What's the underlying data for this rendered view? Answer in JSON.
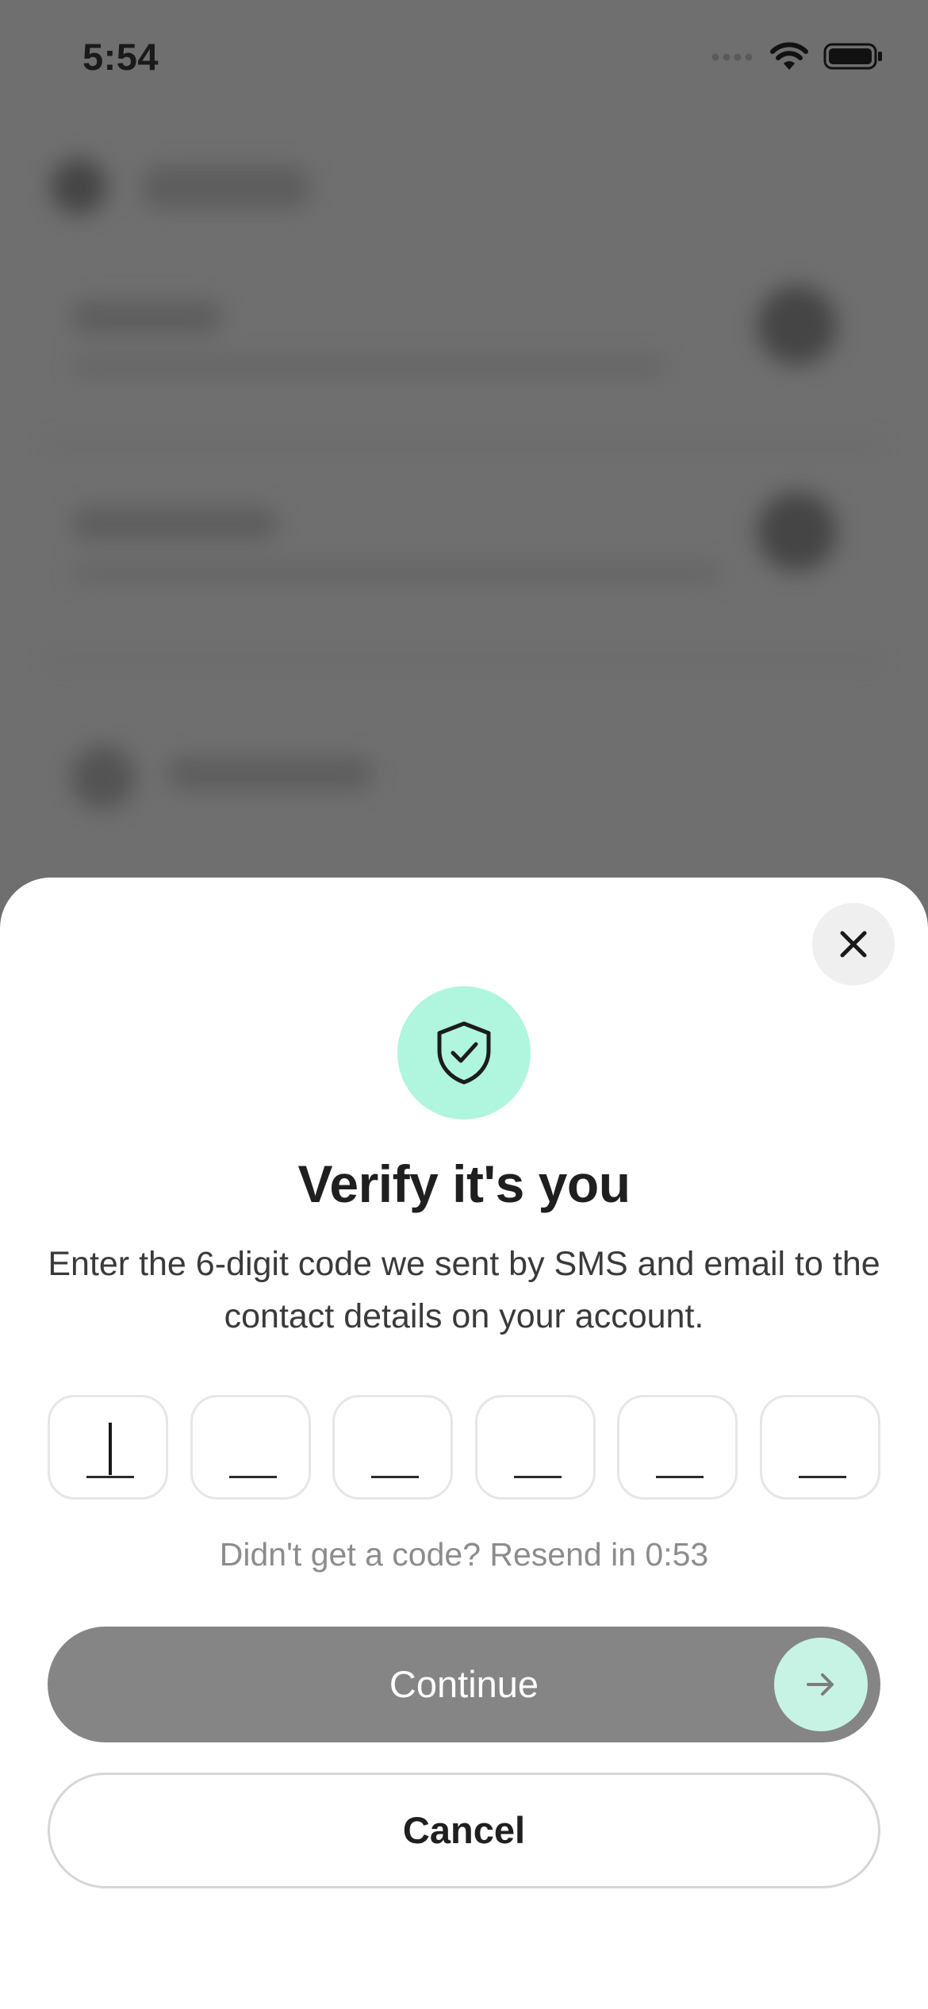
{
  "status_bar": {
    "time": "5:54"
  },
  "sheet": {
    "close_icon": "close-icon",
    "badge_icon": "shield-check-icon",
    "title": "Verify it's you",
    "description": "Enter the 6-digit code we sent by SMS and email to the contact details on your account.",
    "otp": {
      "digits": [
        "",
        "",
        "",
        "",
        "",
        ""
      ],
      "length": 6
    },
    "resend_text": "Didn't get a code? Resend in 0:53",
    "continue_label": "Continue",
    "continue_icon": "arrow-right-icon",
    "cancel_label": "Cancel"
  },
  "colors": {
    "accent_mint": "#b0f5de",
    "continue_disabled": "#858585",
    "overlay": "#6f6f6f"
  }
}
